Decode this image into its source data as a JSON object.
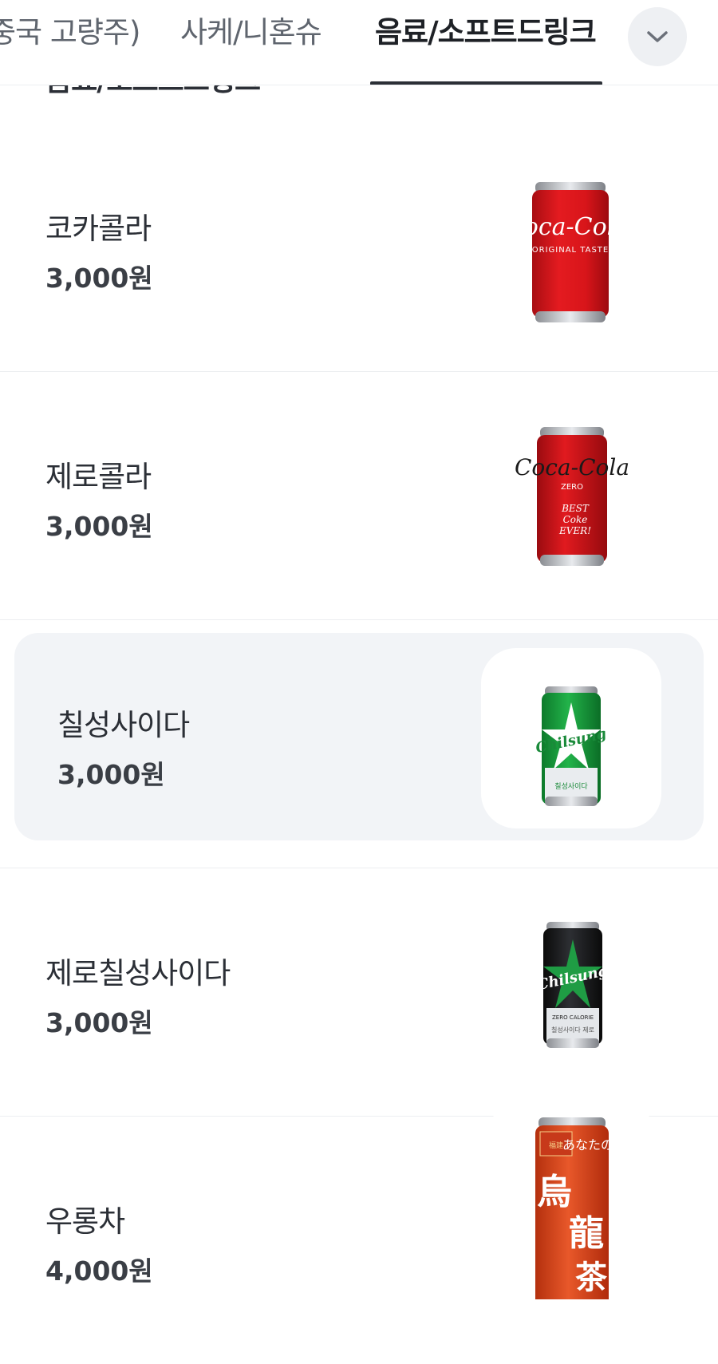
{
  "tabs": [
    {
      "label": "중국 고량주)",
      "active": false
    },
    {
      "label": "사케/니혼슈",
      "active": false
    },
    {
      "label": "음료/소프트드링크",
      "active": true
    }
  ],
  "section_title": "음료/소프트드링크",
  "items": [
    {
      "name": "코카콜라",
      "price": "3,000원",
      "image_icon": "coca-cola-can",
      "selected": false
    },
    {
      "name": "제로콜라",
      "price": "3,000원",
      "image_icon": "coca-cola-zero-can",
      "selected": false
    },
    {
      "name": "칠성사이다",
      "price": "3,000원",
      "image_icon": "chilsung-cider-can",
      "selected": true
    },
    {
      "name": "제로칠성사이다",
      "price": "3,000원",
      "image_icon": "chilsung-zero-can",
      "selected": false
    },
    {
      "name": "우롱차",
      "price": "4,000원",
      "image_icon": "oolong-tea-can",
      "selected": false
    }
  ],
  "colors": {
    "tab_active": "#1e2126",
    "tab_inactive": "#5f656e",
    "selected_card": "#f2f4f7",
    "divider": "#eceef1"
  }
}
